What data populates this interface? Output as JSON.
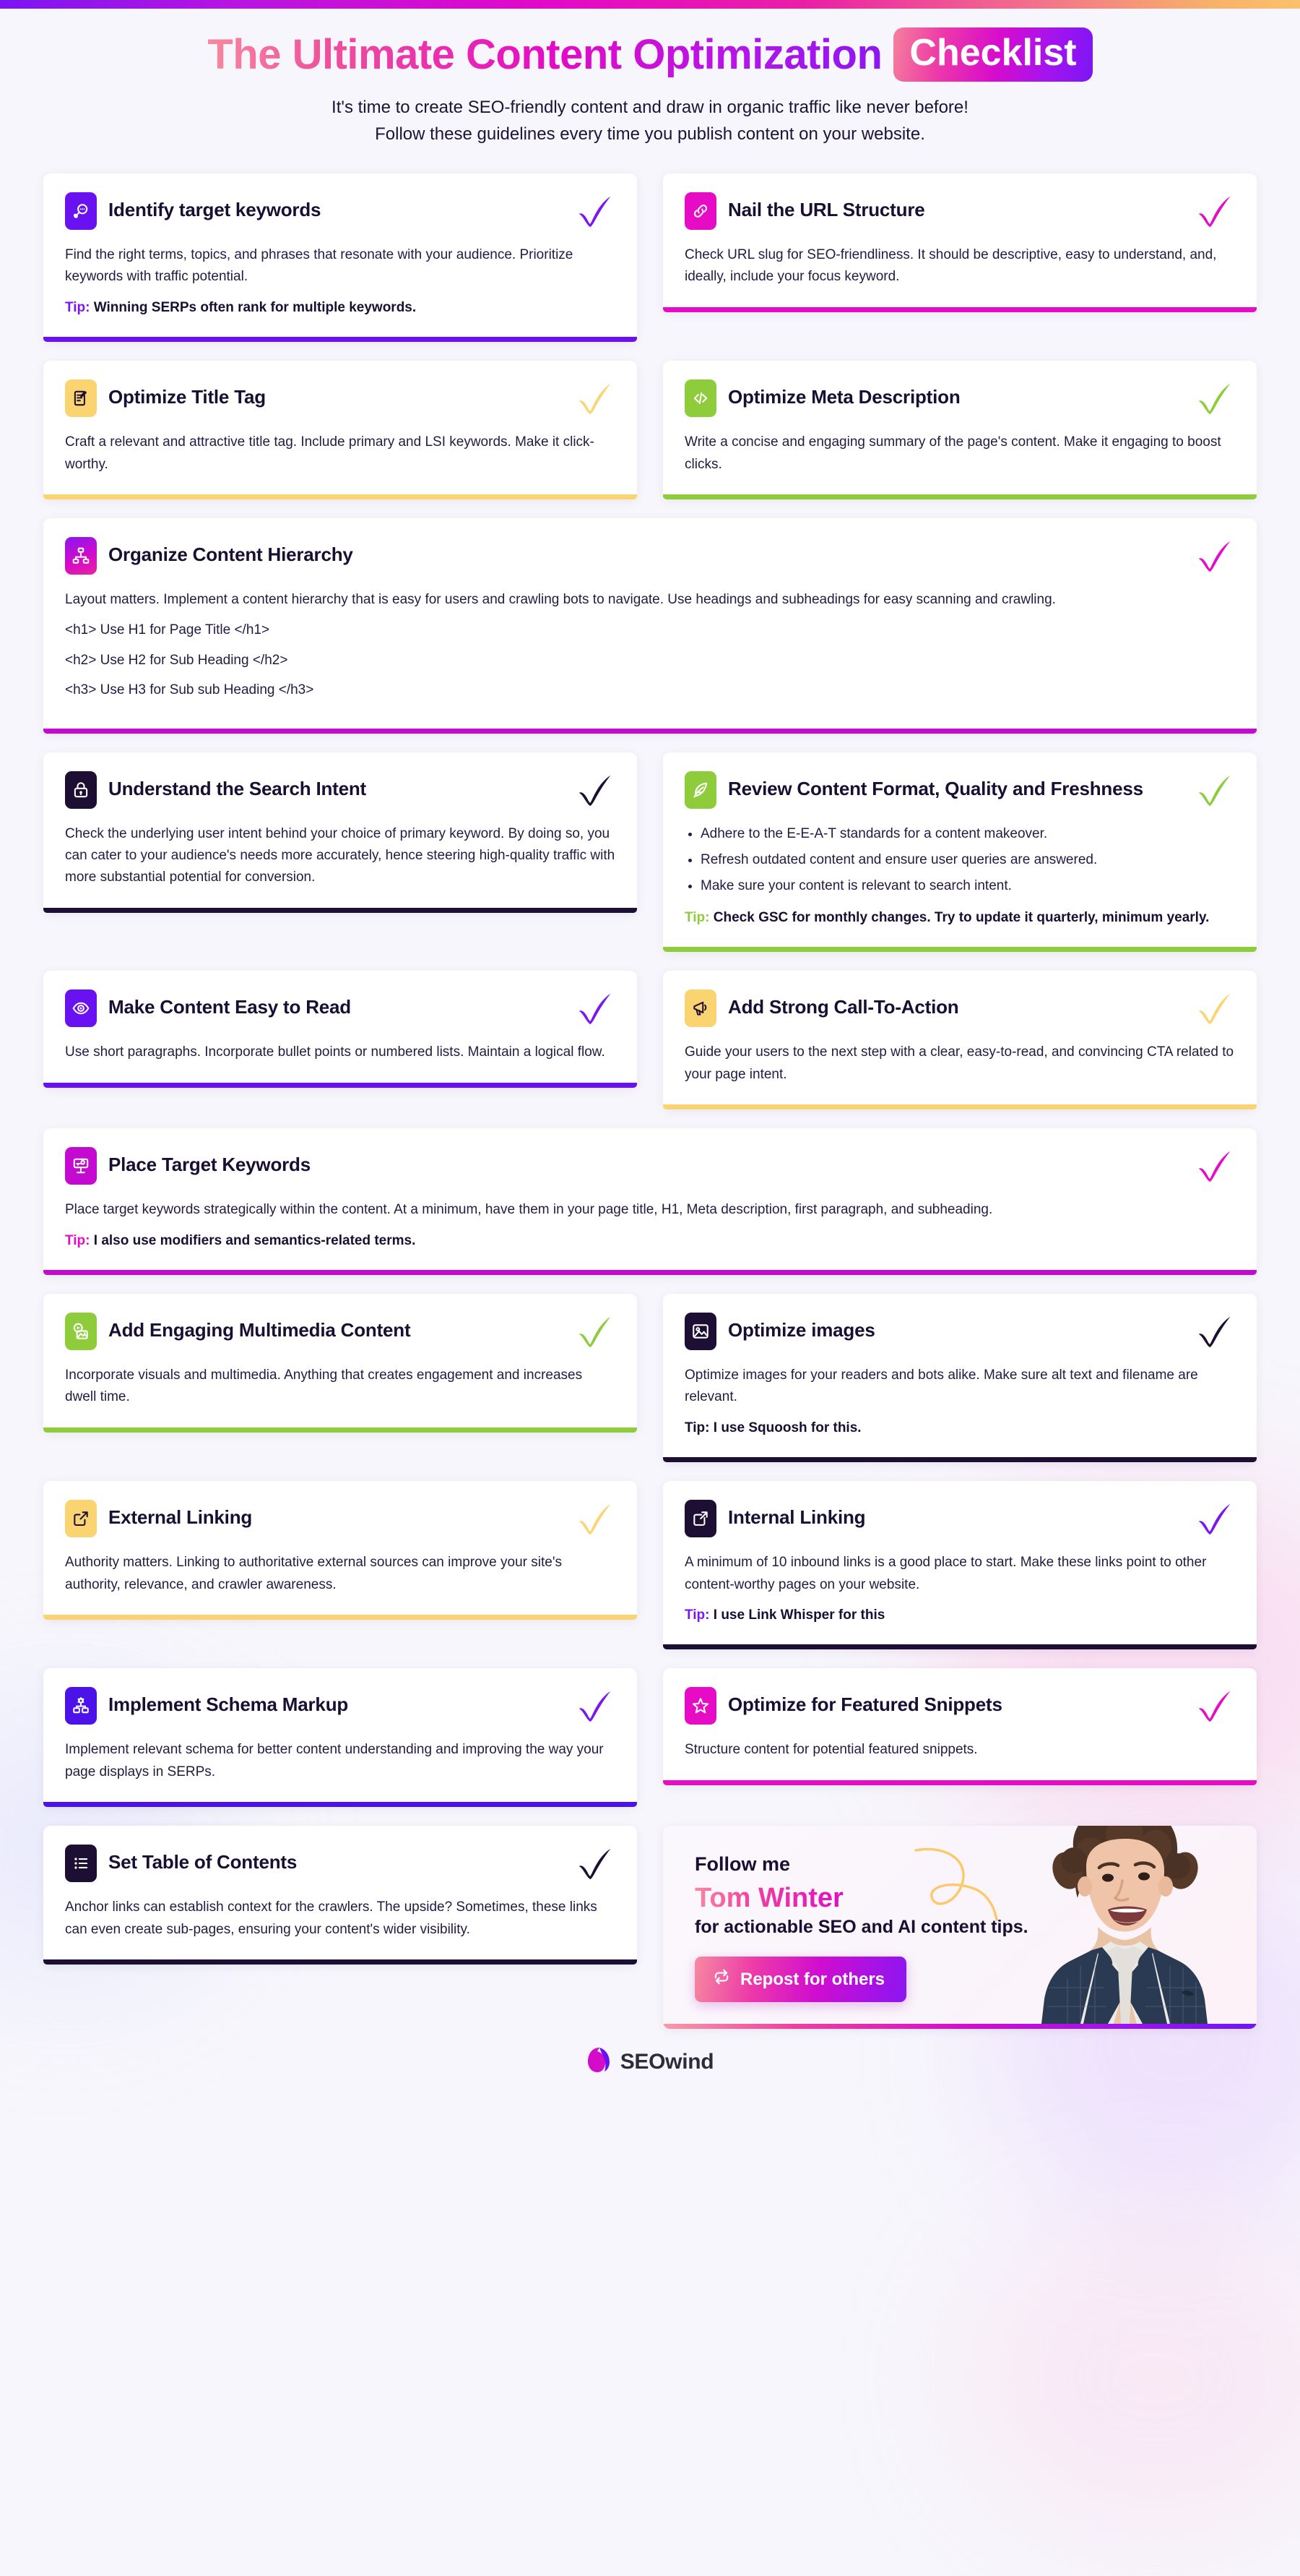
{
  "header": {
    "title_main": "The Ultimate Content Optimization",
    "title_badge": "Checklist",
    "subtitle_line1": "It's time to create SEO-friendly content and draw in organic traffic like never before!",
    "subtitle_line2": "Follow these guidelines every time you publish content on your website."
  },
  "colors": {
    "purple": "#6a11f2",
    "magenta": "#e60cc6",
    "yellow": "#fbd472",
    "green": "#8fcc3c",
    "dark": "#1c0f33",
    "violet": "#7b16f0"
  },
  "cards": [
    {
      "id": "identify-target-keywords",
      "title": "Identify target keywords",
      "icon": "search-keyword-icon",
      "accent": "#6a11f2",
      "tick_color": "#7b16f0",
      "width": "half",
      "body": [
        "Find the right terms, topics, and phrases that resonate with your audience. Prioritize keywords with traffic potential."
      ],
      "tip_label": "Tip:",
      "tip_text": "Winning SERPs often rank for multiple keywords.",
      "tip_label_color": "#7b16f0"
    },
    {
      "id": "nail-the-url-structure",
      "title": "Nail the URL Structure",
      "icon": "link-chain-icon",
      "accent": "#e60cc6",
      "tick_color": "#e60cc6",
      "width": "half",
      "body": [
        "Check URL slug for SEO-friendliness. It should be descriptive, easy to understand, and, ideally, include your focus keyword."
      ]
    },
    {
      "id": "optimize-title-tag",
      "title": "Optimize Title Tag",
      "icon": "document-pencil-icon",
      "accent": "#fbd472",
      "tick_color": "#fbd472",
      "width": "half",
      "body": [
        "Craft a relevant and attractive title tag. Include primary and LSI keywords. Make it click-worthy."
      ]
    },
    {
      "id": "optimize-meta-description",
      "title": "Optimize Meta Description",
      "icon": "code-tag-icon",
      "accent": "#8fcc3c",
      "tick_color": "#8fcc3c",
      "width": "half",
      "body": [
        "Write a concise and engaging summary of the page's content. Make it engaging to boost clicks."
      ]
    },
    {
      "id": "organize-content-hierarchy",
      "title": "Organize Content Hierarchy",
      "icon": "hierarchy-tree-icon",
      "accent": "#c40ad0",
      "tick_color": "#e60cc6",
      "width": "full",
      "icon_gradient": true,
      "body": [
        "Layout matters. Implement a content hierarchy that is easy for users and crawling bots to navigate. Use headings and subheadings for easy scanning and crawling."
      ],
      "code_lines": [
        "<h1> Use H1 for Page Title </h1>",
        "<h2> Use H2 for Sub Heading </h2>",
        "<h3> Use H3 for Sub sub Heading </h3>"
      ]
    },
    {
      "id": "understand-the-search-intent",
      "title": "Understand the Search Intent",
      "icon": "lock-icon",
      "accent": "#1c0f33",
      "tick_color": "#1c0f33",
      "width": "half",
      "body": [
        "Check the underlying user intent behind your choice of primary keyword. By doing so, you can cater to your audience's needs more accurately, hence steering high-quality traffic with more substantial potential for conversion."
      ]
    },
    {
      "id": "review-content-format-quality-and-freshness",
      "title": "Review Content Format, Quality and Freshness",
      "icon": "quill-edit-icon",
      "accent": "#8fcc3c",
      "tick_color": "#8fcc3c",
      "width": "half",
      "bullets": [
        "Adhere to the E-E-A-T standards for a content makeover.",
        "Refresh outdated content and ensure user queries are answered.",
        "Make sure your content is relevant to search intent."
      ],
      "tip_label": "Tip:",
      "tip_text": "Check GSC for monthly changes. Try to update it quarterly, minimum yearly.",
      "tip_label_color": "#8fcc3c"
    },
    {
      "id": "make-content-easy-to-read",
      "title": "Make Content Easy to Read",
      "icon": "eye-icon",
      "accent": "#6a11f2",
      "tick_color": "#7b16f0",
      "width": "half",
      "body": [
        "Use short paragraphs. Incorporate bullet points or numbered lists. Maintain a logical flow."
      ]
    },
    {
      "id": "add-strong-call-to-action",
      "title": "Add Strong Call-To-Action",
      "icon": "megaphone-icon",
      "accent": "#fbd472",
      "tick_color": "#fbd472",
      "width": "half",
      "body": [
        "Guide your users to the next step with a clear, easy-to-read, and convincing CTA related to your page intent."
      ]
    },
    {
      "id": "place-target-keywords",
      "title": "Place Target Keywords",
      "icon": "keyword-placement-icon",
      "accent": "#c40ad0",
      "tick_color": "#e60cc6",
      "width": "full",
      "body": [
        "Place target keywords strategically within the content. At a minimum, have them in your page title, H1, Meta description, first paragraph, and subheading."
      ],
      "tip_label": "Tip:",
      "tip_text": "I also use modifiers and semantics-related terms.",
      "tip_label_color": "#e60cc6"
    },
    {
      "id": "add-engaging-multimedia-content",
      "title": "Add Engaging Multimedia Content",
      "icon": "media-image-icon",
      "accent": "#8fcc3c",
      "tick_color": "#8fcc3c",
      "width": "half",
      "body": [
        "Incorporate visuals and multimedia. Anything that creates engagement and increases dwell time."
      ]
    },
    {
      "id": "optimize-images",
      "title": "Optimize images",
      "icon": "picture-icon",
      "accent": "#1c0f33",
      "tick_color": "#1c0f33",
      "width": "half",
      "body": [
        "Optimize images for your readers and bots alike. Make sure alt text and filename are relevant."
      ],
      "tip_label": "Tip:",
      "tip_text": "I use Squoosh for this.",
      "tip_label_color": "#190f33"
    },
    {
      "id": "external-linking",
      "title": "External Linking",
      "icon": "external-link-icon",
      "accent": "#fbd472",
      "tick_color": "#fbd472",
      "width": "half",
      "body": [
        "Authority matters. Linking to authoritative external sources can improve your site's authority, relevance, and crawler awareness."
      ]
    },
    {
      "id": "internal-linking",
      "title": "Internal Linking",
      "icon": "internal-link-icon",
      "accent": "#1c0f33",
      "tick_color": "#7b16f0",
      "width": "half",
      "body": [
        "A minimum of 10 inbound links is a good place to start. Make these links point to other content-worthy pages on your website."
      ],
      "tip_label": "Tip:",
      "tip_text": "I use Link Whisper for this",
      "tip_label_color": "#7b16f0"
    },
    {
      "id": "implement-schema-markup",
      "title": "Implement Schema Markup",
      "icon": "schema-gear-icon",
      "accent": "#4b13e8",
      "tick_color": "#7b16f0",
      "width": "half",
      "body": [
        "Implement relevant schema for better content understanding and improving the way your page displays in SERPs."
      ]
    },
    {
      "id": "optimize-for-featured-snippets",
      "title": "Optimize for Featured Snippets",
      "icon": "star-icon",
      "accent": "#e60cc6",
      "tick_color": "#e60cc6",
      "width": "half",
      "body": [
        "Structure content for potential featured snippets."
      ]
    },
    {
      "id": "set-table-of-contents",
      "title": "Set Table of Contents",
      "icon": "list-contents-icon",
      "accent": "#1c0f33",
      "tick_color": "#1c0f33",
      "width": "half",
      "body": [
        "Anchor links can establish context for the crawlers. The upside? Sometimes, these links can even create sub-pages, ensuring your content's wider visibility."
      ]
    }
  ],
  "author": {
    "follow_label": "Follow me",
    "name": "Tom Winter",
    "tagline": "for actionable SEO and AI content tips.",
    "button_label": "Repost for others",
    "button_icon": "repost-icon"
  },
  "footer": {
    "brand": "SEOwind",
    "logo_icon": "seowind-logo-icon"
  }
}
